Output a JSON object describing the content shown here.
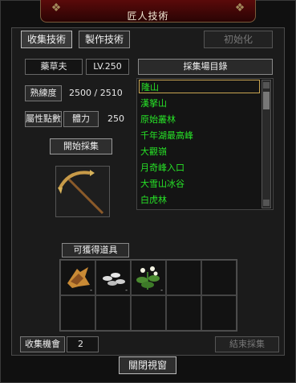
{
  "window": {
    "title": "匠人技術",
    "close_label": "關閉視窗"
  },
  "tabs": [
    {
      "label": "收集技術",
      "active": true
    },
    {
      "label": "製作技術",
      "active": false
    }
  ],
  "reset_label": "初始化",
  "profile": {
    "job": "藥草夫",
    "level": "LV.250",
    "proficiency_label": "熟練度",
    "proficiency_value": "2500 / 2510",
    "attr_label": "屬性點數",
    "attr_name": "體力",
    "attr_value": "250"
  },
  "start_label": "開始採集",
  "tool_icon": "pickaxe-icon",
  "location_list": {
    "header": "採集場目錄",
    "items": [
      "隆山",
      "漢拏山",
      "原始叢林",
      "千年湖最高峰",
      "大觀嶺",
      "月奇峰入口",
      "大雪山冰谷",
      "白虎林"
    ],
    "selected_index": 0,
    "item_color": "#27e327"
  },
  "obtainable": {
    "header": "可獲得道具",
    "items": [
      {
        "icon": "herb-root-icon",
        "qty": "-"
      },
      {
        "icon": "seeds-icon",
        "qty": "-"
      },
      {
        "icon": "flower-plant-icon",
        "qty": "-"
      }
    ]
  },
  "footer": {
    "chance_label": "收集機會",
    "chance_value": "2",
    "end_label": "結束採集"
  }
}
